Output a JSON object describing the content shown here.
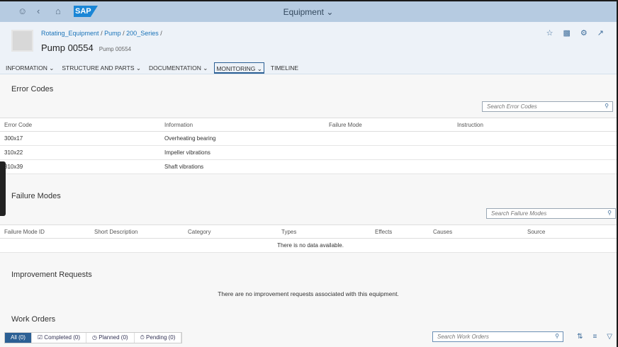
{
  "shell": {
    "title": "Equipment",
    "logo": "SAP"
  },
  "header": {
    "breadcrumb": [
      "Rotating_Equipment",
      "Pump",
      "200_Series"
    ],
    "title": "Pump 00554",
    "subtitle": "Pump 00554"
  },
  "tabs": [
    "INFORMATION",
    "STRUCTURE AND PARTS",
    "DOCUMENTATION",
    "MONITORING",
    "TIMELINE"
  ],
  "error_codes": {
    "title": "Error Codes",
    "search_placeholder": "Search Error Codes",
    "columns": [
      "Error Code",
      "Information",
      "Failure Mode",
      "Instruction"
    ],
    "rows": [
      [
        "300x17",
        "Overheating bearing",
        "",
        ""
      ],
      [
        "310x22",
        "Impeller vibrations",
        "",
        ""
      ],
      [
        "310x39",
        "Shaft vibrations",
        "",
        ""
      ]
    ]
  },
  "failure_modes": {
    "title": "Failure Modes",
    "search_placeholder": "Search Failure Modes",
    "columns": [
      "Failure Mode ID",
      "Short Description",
      "Category",
      "Types",
      "Effects",
      "Causes",
      "Source"
    ],
    "empty": "There is no data available."
  },
  "improvement": {
    "title": "Improvement Requests",
    "empty": "There are no improvement requests associated with this equipment."
  },
  "work_orders": {
    "title": "Work Orders",
    "filters": [
      "All (0)",
      "Completed (0)",
      "Planned (0)",
      "Pending (0)"
    ],
    "search_placeholder": "Search Work Orders"
  }
}
